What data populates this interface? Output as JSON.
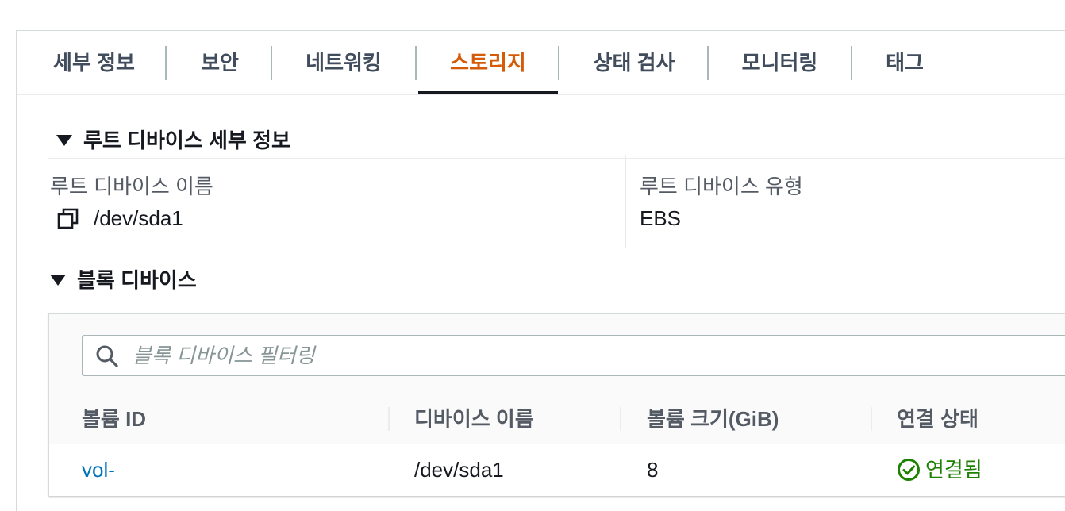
{
  "tabs": [
    {
      "label": "세부 정보",
      "active": false
    },
    {
      "label": "보안",
      "active": false
    },
    {
      "label": "네트워킹",
      "active": false
    },
    {
      "label": "스토리지",
      "active": true
    },
    {
      "label": "상태 검사",
      "active": false
    },
    {
      "label": "모니터링",
      "active": false
    },
    {
      "label": "태그",
      "active": false
    }
  ],
  "root_device": {
    "section_title": "루트 디바이스 세부 정보",
    "name_label": "루트 디바이스 이름",
    "name_value": "/dev/sda1",
    "type_label": "루트 디바이스 유형",
    "type_value": "EBS"
  },
  "block_devices": {
    "section_title": "블록 디바이스",
    "filter_placeholder": "블록 디바이스 필터링",
    "filter_value": "",
    "columns": [
      "볼륨 ID",
      "디바이스 이름",
      "볼륨 크기(GiB)",
      "연결 상태"
    ],
    "rows": [
      {
        "volume_id": "vol-",
        "device_name": "/dev/sda1",
        "size": "8",
        "status": "연결됨"
      }
    ]
  },
  "colors": {
    "active_tab": "#d45b07",
    "link": "#0073bb",
    "success": "#1d8102",
    "text": "#16191f",
    "muted": "#545b64"
  },
  "icons": {
    "copy": "copy-icon",
    "search": "search-icon",
    "status": "check-circle-icon",
    "caret": "caret-down-icon"
  }
}
